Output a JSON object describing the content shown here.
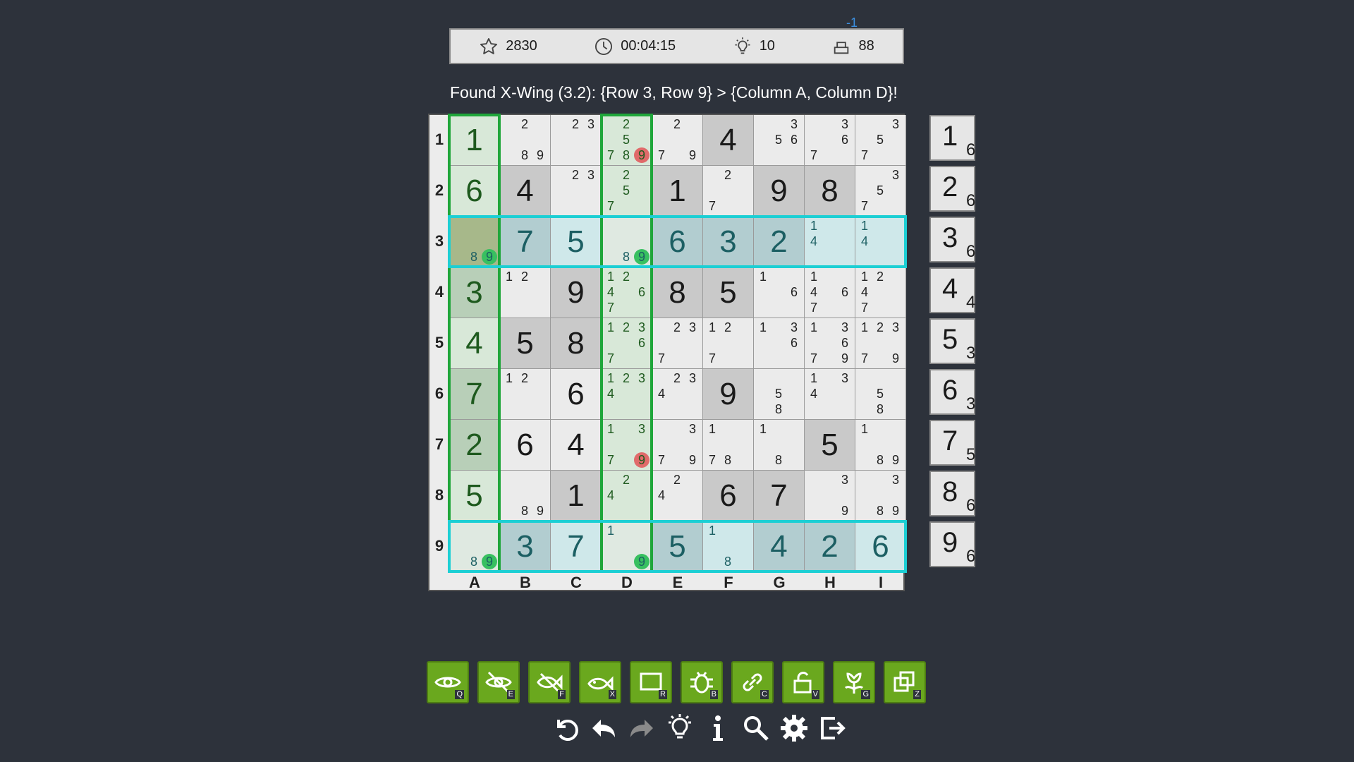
{
  "status": {
    "score": "2830",
    "time": "00:04:15",
    "hints": "10",
    "remaining": "88",
    "delta": "-1"
  },
  "hint_text": "Found X-Wing (3.2): {Row 3, Row 9} > {Column A, Column D}!",
  "row_labels": [
    "1",
    "2",
    "3",
    "4",
    "5",
    "6",
    "7",
    "8",
    "9"
  ],
  "col_labels": [
    "A",
    "B",
    "C",
    "D",
    "E",
    "F",
    "G",
    "H",
    "I"
  ],
  "grid": [
    [
      {
        "v": "1"
      },
      {
        "c": [
          "2",
          "8",
          "9"
        ]
      },
      {
        "c": [
          "2",
          "3"
        ]
      },
      {
        "c": [
          "2",
          "5",
          "7",
          "8",
          "9"
        ]
      },
      {
        "c": [
          "2",
          "7",
          "9"
        ]
      },
      {
        "v": "4",
        "g": true
      },
      {
        "c": [
          "3",
          "5",
          "6"
        ]
      },
      {
        "c": [
          "3",
          "6",
          "7"
        ]
      },
      {
        "c": [
          "3",
          "5",
          "7"
        ]
      }
    ],
    [
      {
        "v": "6"
      },
      {
        "v": "4",
        "g": true
      },
      {
        "c": [
          "2",
          "3"
        ]
      },
      {
        "c": [
          "2",
          "5",
          "7"
        ]
      },
      {
        "v": "1",
        "g": true
      },
      {
        "c": [
          "2",
          "7"
        ]
      },
      {
        "v": "9",
        "g": true
      },
      {
        "v": "8",
        "g": true
      },
      {
        "c": [
          "3",
          "5",
          "7"
        ]
      }
    ],
    [
      {
        "c": [
          "8",
          "9"
        ]
      },
      {
        "v": "7",
        "g": true
      },
      {
        "v": "5"
      },
      {
        "c": [
          "8",
          "9"
        ]
      },
      {
        "v": "6",
        "g": true
      },
      {
        "v": "3",
        "g": true
      },
      {
        "v": "2",
        "g": true
      },
      {
        "c": [
          "1",
          "4"
        ]
      },
      {
        "c": [
          "1",
          "4"
        ]
      }
    ],
    [
      {
        "v": "3",
        "g": true
      },
      {
        "c": [
          "1",
          "2"
        ]
      },
      {
        "v": "9",
        "g": true
      },
      {
        "c": [
          "1",
          "2",
          "4",
          "6",
          "7"
        ]
      },
      {
        "v": "8",
        "g": true
      },
      {
        "v": "5",
        "g": true
      },
      {
        "c": [
          "1",
          "6"
        ]
      },
      {
        "c": [
          "1",
          "4",
          "6",
          "7"
        ]
      },
      {
        "c": [
          "1",
          "2",
          "4",
          "7"
        ]
      }
    ],
    [
      {
        "v": "4"
      },
      {
        "v": "5",
        "g": true
      },
      {
        "v": "8",
        "g": true
      },
      {
        "c": [
          "1",
          "2",
          "3",
          "6",
          "7"
        ]
      },
      {
        "c": [
          "2",
          "3",
          "7"
        ]
      },
      {
        "c": [
          "1",
          "2",
          "7"
        ]
      },
      {
        "c": [
          "1",
          "3",
          "6"
        ]
      },
      {
        "c": [
          "1",
          "3",
          "6",
          "7",
          "9"
        ]
      },
      {
        "c": [
          "1",
          "2",
          "3",
          "7",
          "9"
        ]
      }
    ],
    [
      {
        "v": "7",
        "g": true
      },
      {
        "c": [
          "1",
          "2"
        ]
      },
      {
        "v": "6"
      },
      {
        "c": [
          "1",
          "2",
          "3",
          "4"
        ]
      },
      {
        "c": [
          "2",
          "3",
          "4"
        ]
      },
      {
        "v": "9",
        "g": true
      },
      {
        "c": [
          "5",
          "8"
        ]
      },
      {
        "c": [
          "1",
          "3",
          "4"
        ]
      },
      {
        "c": [
          "5",
          "8"
        ]
      }
    ],
    [
      {
        "v": "2",
        "g": true
      },
      {
        "v": "6"
      },
      {
        "v": "4"
      },
      {
        "c": [
          "1",
          "3",
          "7",
          "9"
        ]
      },
      {
        "c": [
          "3",
          "7",
          "9"
        ]
      },
      {
        "c": [
          "1",
          "7",
          "8"
        ]
      },
      {
        "c": [
          "1",
          "8"
        ]
      },
      {
        "v": "5",
        "g": true
      },
      {
        "c": [
          "1",
          "8",
          "9"
        ]
      }
    ],
    [
      {
        "v": "5"
      },
      {
        "c": [
          "8",
          "9"
        ]
      },
      {
        "v": "1",
        "g": true
      },
      {
        "c": [
          "2",
          "4"
        ]
      },
      {
        "c": [
          "2",
          "4"
        ]
      },
      {
        "v": "6",
        "g": true
      },
      {
        "v": "7",
        "g": true
      },
      {
        "c": [
          "3",
          "9"
        ]
      },
      {
        "c": [
          "3",
          "8",
          "9"
        ]
      }
    ],
    [
      {
        "c": [
          "8",
          "9"
        ]
      },
      {
        "v": "3",
        "g": true
      },
      {
        "v": "7"
      },
      {
        "c": [
          "1",
          "9"
        ]
      },
      {
        "v": "5",
        "g": true
      },
      {
        "c": [
          "1",
          "8"
        ]
      },
      {
        "v": "4",
        "g": true
      },
      {
        "v": "2",
        "g": true
      },
      {
        "v": "6"
      }
    ]
  ],
  "eliminated": [
    [
      0,
      3,
      "9"
    ],
    [
      6,
      3,
      "9"
    ]
  ],
  "highlighted_candidates": [
    [
      2,
      0,
      "9"
    ],
    [
      2,
      3,
      "9"
    ],
    [
      8,
      0,
      "9"
    ],
    [
      8,
      3,
      "9"
    ]
  ],
  "highlight_rows": [
    2,
    8
  ],
  "highlight_cols": [
    0,
    3
  ],
  "digit_counts": [
    {
      "digit": "1",
      "count": "6"
    },
    {
      "digit": "2",
      "count": "6"
    },
    {
      "digit": "3",
      "count": "6"
    },
    {
      "digit": "4",
      "count": "4"
    },
    {
      "digit": "5",
      "count": "3"
    },
    {
      "digit": "6",
      "count": "3"
    },
    {
      "digit": "7",
      "count": "5"
    },
    {
      "digit": "8",
      "count": "6"
    },
    {
      "digit": "9",
      "count": "6"
    }
  ],
  "tools": [
    {
      "icon": "eye-icon",
      "key": "Q"
    },
    {
      "icon": "eye-off-icon",
      "key": "E"
    },
    {
      "icon": "fish-icon",
      "key": "F"
    },
    {
      "icon": "x-wing-fish-icon",
      "key": "X"
    },
    {
      "icon": "rectangle-icon",
      "key": "R"
    },
    {
      "icon": "bug-icon",
      "key": "B"
    },
    {
      "icon": "chain-icon",
      "key": "C"
    },
    {
      "icon": "unlock-icon",
      "key": "V"
    },
    {
      "icon": "flower-icon",
      "key": "G"
    },
    {
      "icon": "copy-icon",
      "key": "Z"
    }
  ],
  "nav": [
    "restart-icon",
    "undo-icon",
    "redo-icon",
    "hint-bulb-icon",
    "info-icon",
    "search-icon",
    "settings-gear-icon",
    "exit-icon"
  ],
  "colors": {
    "background": "#2d323b",
    "tool_green": "#6aa81e",
    "column_outline": "#1fa63a",
    "row_outline": "#1ccfd4",
    "eliminated_candidate": "#e06a6a",
    "kept_candidate": "#38c060"
  }
}
